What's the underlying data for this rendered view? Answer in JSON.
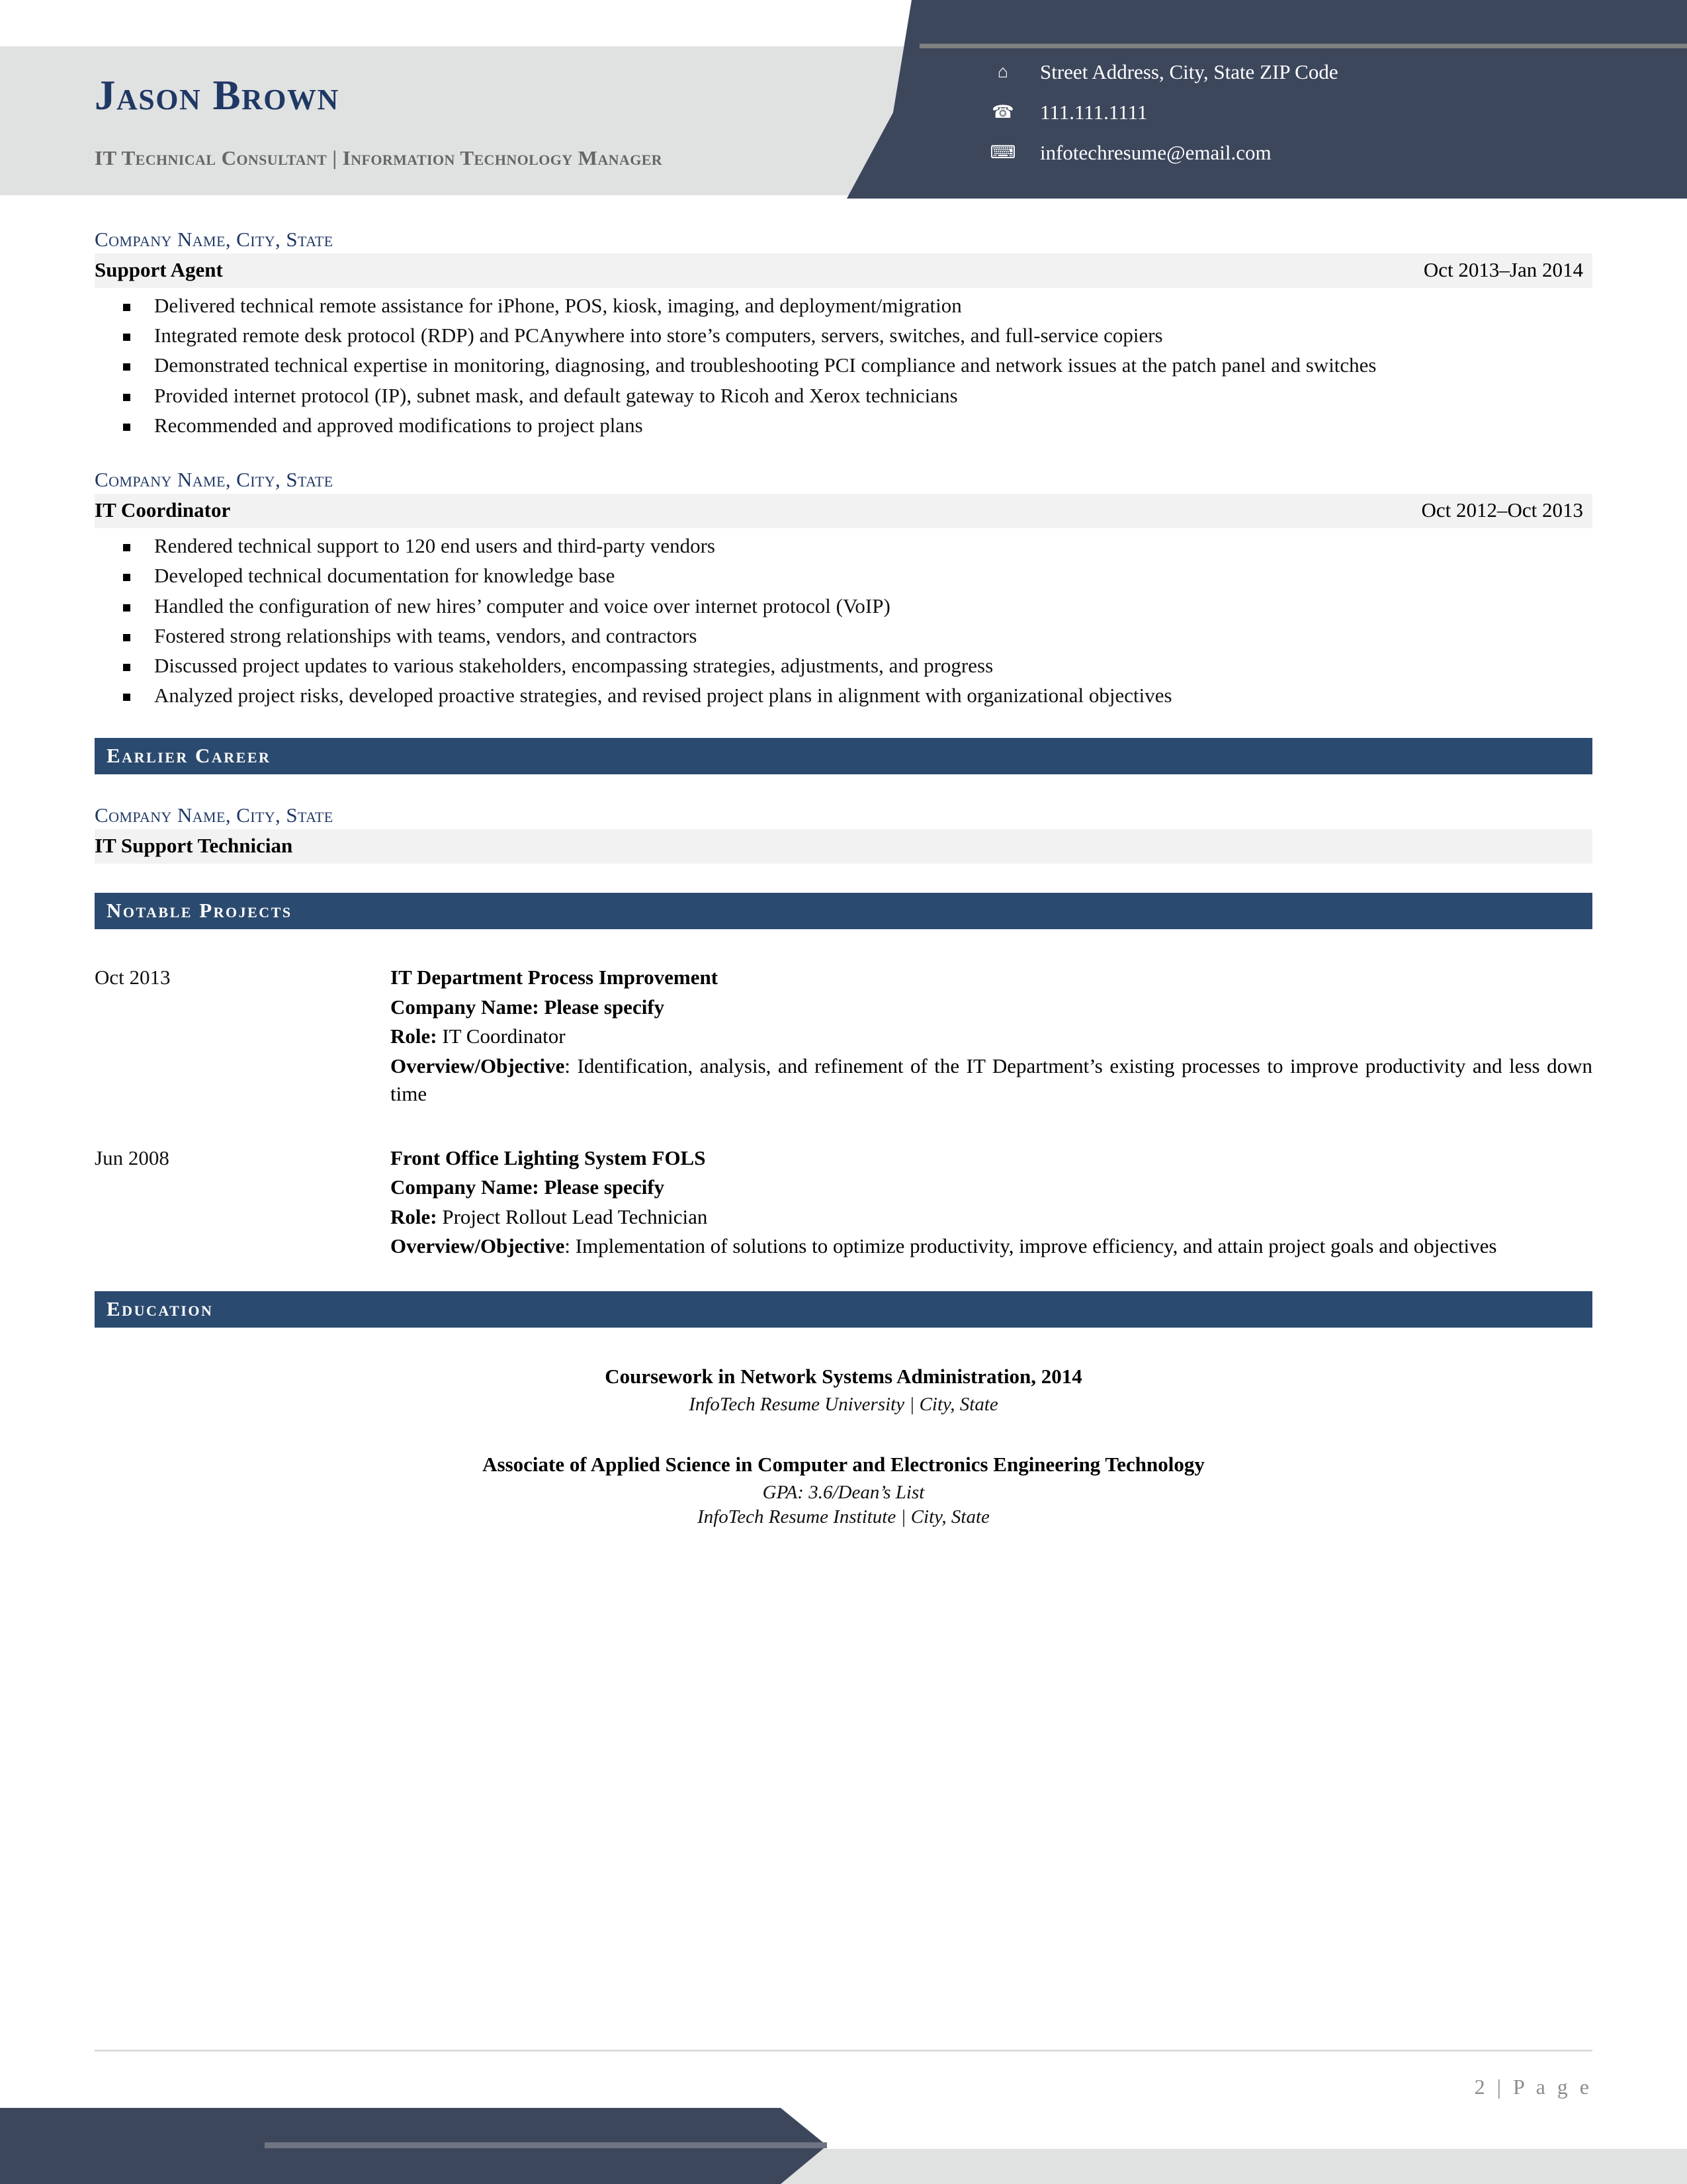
{
  "theme": {
    "navy_header": "#3d475c",
    "section_bar": "#2b4a6f",
    "company_blue": "#1f3864",
    "gray_band": "#e0e1e1",
    "job_bar": "#f2f2f2"
  },
  "header": {
    "name": "Jason Brown",
    "subtitle": "IT Technical Consultant | Information Technology Manager",
    "contacts": [
      {
        "icon": "address-icon",
        "glyph": "⌂",
        "text": "Street Address, City, State ZIP Code"
      },
      {
        "icon": "phone-icon",
        "glyph": "☎",
        "text": "111.111.1111"
      },
      {
        "icon": "email-icon",
        "glyph": "⌨",
        "text": "infotechresume@email.com"
      }
    ]
  },
  "experience": [
    {
      "company": "Company Name, City, State",
      "title": "Support Agent",
      "dates": "Oct 2013–Jan 2014",
      "bullets": [
        "Delivered technical remote assistance for iPhone, POS, kiosk, imaging, and deployment/migration",
        "Integrated remote desk protocol (RDP) and PCAnywhere into store’s computers, servers, switches, and full-service copiers",
        "Demonstrated technical expertise in monitoring, diagnosing, and troubleshooting PCI compliance and network issues at the patch panel and switches",
        "Provided internet protocol (IP), subnet mask, and default gateway to Ricoh and Xerox technicians",
        "Recommended and approved modifications to project plans"
      ]
    },
    {
      "company": "Company Name, City, State",
      "title": "IT Coordinator",
      "dates": "Oct 2012–Oct 2013",
      "bullets": [
        "Rendered technical support to 120 end users and third-party vendors",
        "Developed technical documentation for knowledge base",
        "Handled the configuration of new hires’ computer and voice over internet protocol (VoIP)",
        "Fostered strong relationships with teams, vendors, and contractors",
        "Discussed project updates to various stakeholders, encompassing strategies, adjustments, and progress",
        "Analyzed project risks, developed proactive strategies, and revised project plans in alignment with organizational objectives"
      ]
    }
  ],
  "earlier_career": {
    "section_title": "Earlier Career",
    "company": "Company Name, City, State",
    "title": "IT Support Technician",
    "dates": ""
  },
  "notable_projects": {
    "section_title": "Notable Projects",
    "labels": {
      "company": "Company Name:",
      "role": "Role:",
      "overview": "Overview/Objective"
    },
    "items": [
      {
        "date": "Oct 2013",
        "name": "IT Department Process Improvement",
        "company_value": "Please specify",
        "role_value": "IT Coordinator",
        "overview_value": ": Identification, analysis, and refinement of the IT Department’s existing processes to improve productivity and less down time"
      },
      {
        "date": "Jun 2008",
        "name": "Front Office Lighting System FOLS",
        "company_value": "Please specify",
        "role_value": "Project Rollout Lead Technician",
        "overview_value": ": Implementation of solutions to optimize productivity, improve efficiency, and attain project goals and objectives"
      }
    ]
  },
  "education": {
    "section_title": "Education",
    "items": [
      {
        "degree": "Coursework in Network Systems Administration, 2014",
        "lines": [
          "InfoTech Resume University | City, State"
        ]
      },
      {
        "degree": "Associate of Applied Science in Computer and Electronics Engineering Technology",
        "lines": [
          "GPA: 3.6/Dean’s List",
          "InfoTech Resume Institute | City, State"
        ]
      }
    ]
  },
  "footer": {
    "page_label": "2 | P a g e"
  }
}
